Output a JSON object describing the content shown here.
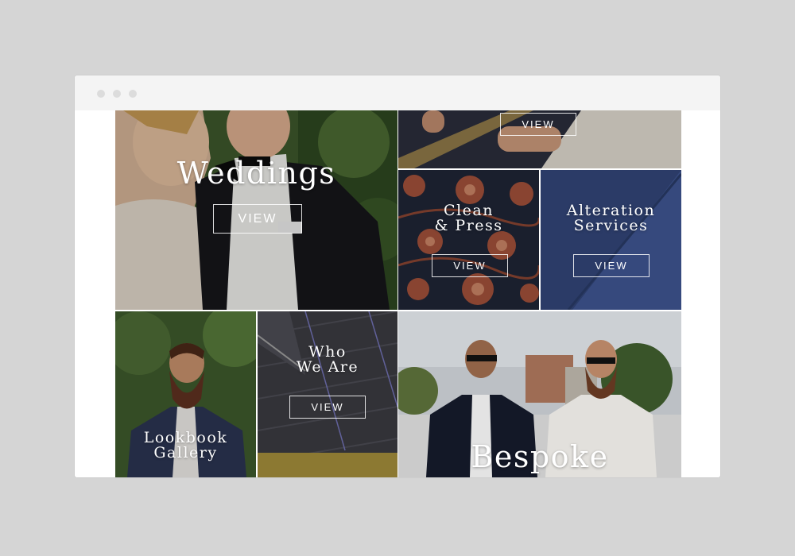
{
  "browser": {
    "window_dots": [
      "close",
      "minimize",
      "maximize"
    ]
  },
  "tiles": {
    "weddings": {
      "title": "Weddings",
      "button": "VIEW"
    },
    "top_right": {
      "button": "VIEW"
    },
    "clean_press": {
      "title_line1": "Clean",
      "title_line2": "& Press",
      "button": "VIEW"
    },
    "alteration": {
      "title_line1": "Alteration",
      "title_line2": "Services",
      "button": "VIEW"
    },
    "lookbook": {
      "title_line1": "Lookbook",
      "title_line2": "Gallery"
    },
    "who_we_are": {
      "title_line1": "Who",
      "title_line2": "We Are",
      "button": "VIEW"
    },
    "bespoke": {
      "title": "Bespoke"
    }
  },
  "colors": {
    "page_background": "#d5d5d5",
    "browser_chrome": "#f4f4f4",
    "text_on_image": "#ffffff"
  }
}
